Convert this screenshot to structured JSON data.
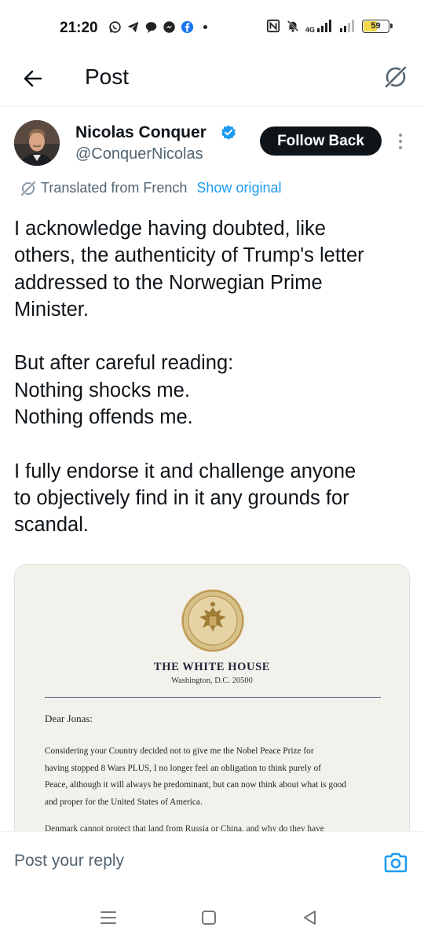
{
  "status_bar": {
    "time": "21:20",
    "battery": "59",
    "network": "4G",
    "icons": [
      "whatsapp-icon",
      "telegram-icon",
      "chat-icon",
      "messenger-icon",
      "facebook-icon",
      "dot-icon",
      "nfc-icon",
      "mute-icon",
      "signal-icon",
      "signal-icon-2",
      "battery-icon"
    ]
  },
  "header": {
    "title": "Post",
    "back_icon": "arrow-left-icon",
    "grok_icon": "grok-icon"
  },
  "author": {
    "name": "Nicolas Conquer",
    "handle": "@ConquerNicolas",
    "verified": true,
    "follow_label": "Follow Back"
  },
  "translation": {
    "translated_label": "Translated from French",
    "show_original_label": "Show original"
  },
  "tweet": {
    "paragraph_1": "I acknowledge having doubted, like\nothers, the authenticity of Trump's letter\naddressed to the Norwegian Prime\nMinister.",
    "paragraph_2": "But after careful reading:\nNothing shocks me.\nNothing offends me.",
    "paragraph_3": "I fully endorse it and challenge anyone\nto objectively find in it any grounds for\nscandal."
  },
  "letter": {
    "heading": "THE WHITE HOUSE",
    "address": "Washington, D.C. 20500",
    "greeting": "Dear Jonas:",
    "body": "Considering your Country decided not to give me the Nobel Peace Prize for\nhaving stopped 8 Wars PLUS, I no longer feel an obligation to think purely of\nPeace, although it will always be predominant, but can now think about what is good\nand proper for the United States of America.",
    "cut_line": "Denmark cannot protect that land from Russia or China, and why do they have"
  },
  "reply": {
    "placeholder": "Post your reply",
    "camera_icon": "camera-icon"
  },
  "nav": {
    "icons": [
      "menu-icon",
      "home-icon",
      "back-icon"
    ]
  },
  "colors": {
    "accent": "#1d9bf0",
    "text": "#0f1419",
    "secondary": "#536471",
    "battery": "#f2d84a"
  }
}
